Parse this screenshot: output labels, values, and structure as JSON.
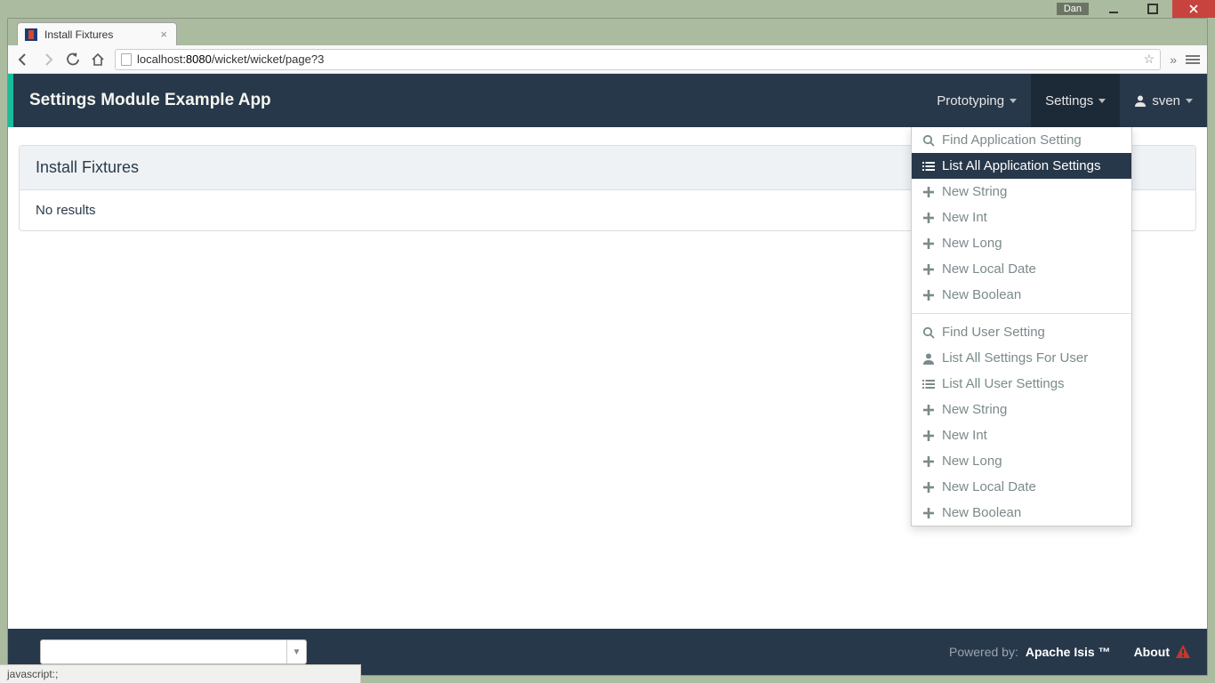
{
  "os": {
    "user_badge": "Dan"
  },
  "browser": {
    "tab_title": "Install Fixtures",
    "url_host_muted": "localhost",
    "url_host_strong": ":8080",
    "url_path": "/wicket/wicket/page?3"
  },
  "navbar": {
    "brand": "Settings Module Example App",
    "menu_prototyping": "Prototyping",
    "menu_settings": "Settings",
    "menu_user": "sven"
  },
  "dropdown": {
    "items": [
      {
        "icon": "search",
        "label": "Find Application Setting",
        "highlight": false
      },
      {
        "icon": "list",
        "label": "List All Application Settings",
        "highlight": true
      },
      {
        "icon": "plus",
        "label": "New String",
        "highlight": false
      },
      {
        "icon": "plus",
        "label": "New Int",
        "highlight": false
      },
      {
        "icon": "plus",
        "label": "New Long",
        "highlight": false
      },
      {
        "icon": "plus",
        "label": "New Local Date",
        "highlight": false
      },
      {
        "icon": "plus",
        "label": "New Boolean",
        "highlight": false
      }
    ],
    "items2": [
      {
        "icon": "search",
        "label": "Find User Setting"
      },
      {
        "icon": "user",
        "label": "List All Settings For User"
      },
      {
        "icon": "list",
        "label": "List All User Settings"
      },
      {
        "icon": "plus",
        "label": "New String"
      },
      {
        "icon": "plus",
        "label": "New Int"
      },
      {
        "icon": "plus",
        "label": "New Long"
      },
      {
        "icon": "plus",
        "label": "New Local Date"
      },
      {
        "icon": "plus",
        "label": "New Boolean"
      }
    ]
  },
  "panel": {
    "title": "Install Fixtures",
    "body": "No results"
  },
  "footer": {
    "powered_by": "Powered by:",
    "powered_link": "Apache Isis ™",
    "about": "About"
  },
  "status": {
    "text": "javascript:;"
  }
}
